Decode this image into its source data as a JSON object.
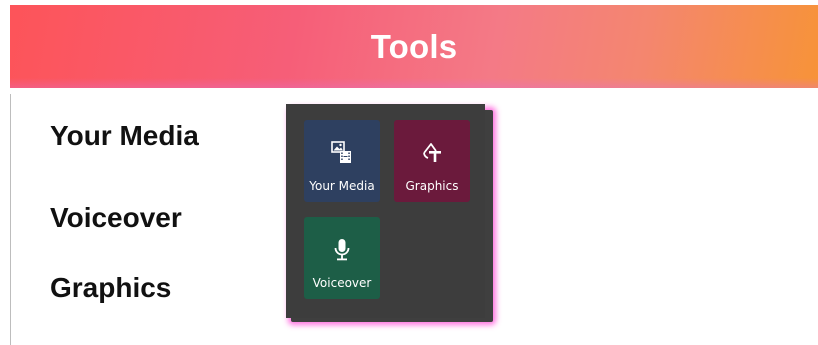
{
  "header": {
    "title": "Tools"
  },
  "menu": {
    "items": [
      {
        "label": "Your Media"
      },
      {
        "label": "Voiceover"
      },
      {
        "label": "Graphics"
      }
    ]
  },
  "tools_panel": {
    "tiles": [
      {
        "label": "Your Media",
        "icon": "media-icon",
        "color": "#2e4060"
      },
      {
        "label": "Graphics",
        "icon": "graphics-text-icon",
        "color": "#6b1a3c"
      },
      {
        "label": "Voiceover",
        "icon": "microphone-icon",
        "color": "#1d5e47"
      }
    ]
  },
  "colors": {
    "header_gradient_start": "#fd5459",
    "header_gradient_end": "#f79338",
    "panel_background": "#3d3d3d",
    "panel_glow": "#ff5adc"
  }
}
